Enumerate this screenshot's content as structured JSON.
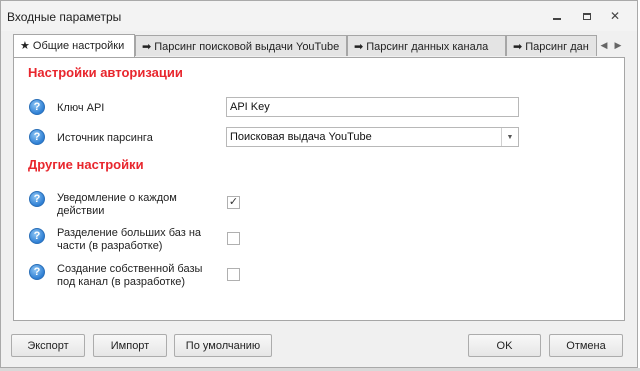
{
  "window": {
    "title": "Входные параметры"
  },
  "tabs": [
    {
      "label": "★ Общие настройки",
      "active": true
    },
    {
      "label": "➡ Парсинг поисковой выдачи YouTube",
      "active": false
    },
    {
      "label": "➡ Парсинг данных канала",
      "active": false
    },
    {
      "label": "➡ Парсинг дан",
      "active": false
    }
  ],
  "tab_scroll": {
    "left": "◀",
    "right": "▶"
  },
  "auth": {
    "title": "Настройки авторизации",
    "api_key_label": "Ключ API",
    "api_key_value": "API Key",
    "source_label": "Источник парсинга",
    "source_value": "Поисковая выдача YouTube"
  },
  "other": {
    "title": "Другие настройки",
    "items": [
      {
        "label_line1": "Уведомление о каждом",
        "label_line2": "действии",
        "checked": true
      },
      {
        "label_line1": "Разделение больших баз на",
        "label_line2": "части (в разработке)",
        "checked": false
      },
      {
        "label_line1": "Создание собственной базы",
        "label_line2": "под канал (в разработке)",
        "checked": false
      }
    ]
  },
  "icons": {
    "help": "?",
    "check": "✓",
    "dropdown": "▼",
    "close": "✕"
  },
  "buttons": {
    "export": "Экспорт",
    "import": "Импорт",
    "default": "По умолчанию",
    "ok": "OK",
    "cancel": "Отмена"
  },
  "colors": {
    "section_title": "#e8262d",
    "help_icon": "#2e7fd4"
  }
}
